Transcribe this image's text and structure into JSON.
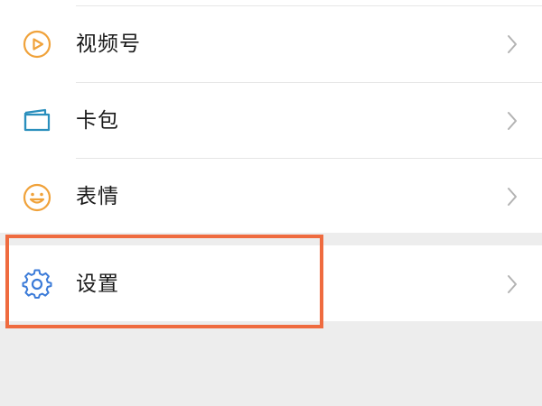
{
  "menu": {
    "items": [
      {
        "label": "视频号",
        "icon": "channels-play-icon",
        "color": "#f0a23a"
      },
      {
        "label": "卡包",
        "icon": "card-wallet-icon",
        "color": "#2a8fbd"
      },
      {
        "label": "表情",
        "icon": "smiley-icon",
        "color": "#f0a23a"
      },
      {
        "label": "设置",
        "icon": "gear-icon",
        "color": "#3b7bd8"
      }
    ]
  },
  "highlight": {
    "color": "#ef6b3f",
    "target": "设置"
  },
  "colors": {
    "background": "#ededed",
    "row": "#ffffff",
    "chevron": "#b3b3b3"
  }
}
